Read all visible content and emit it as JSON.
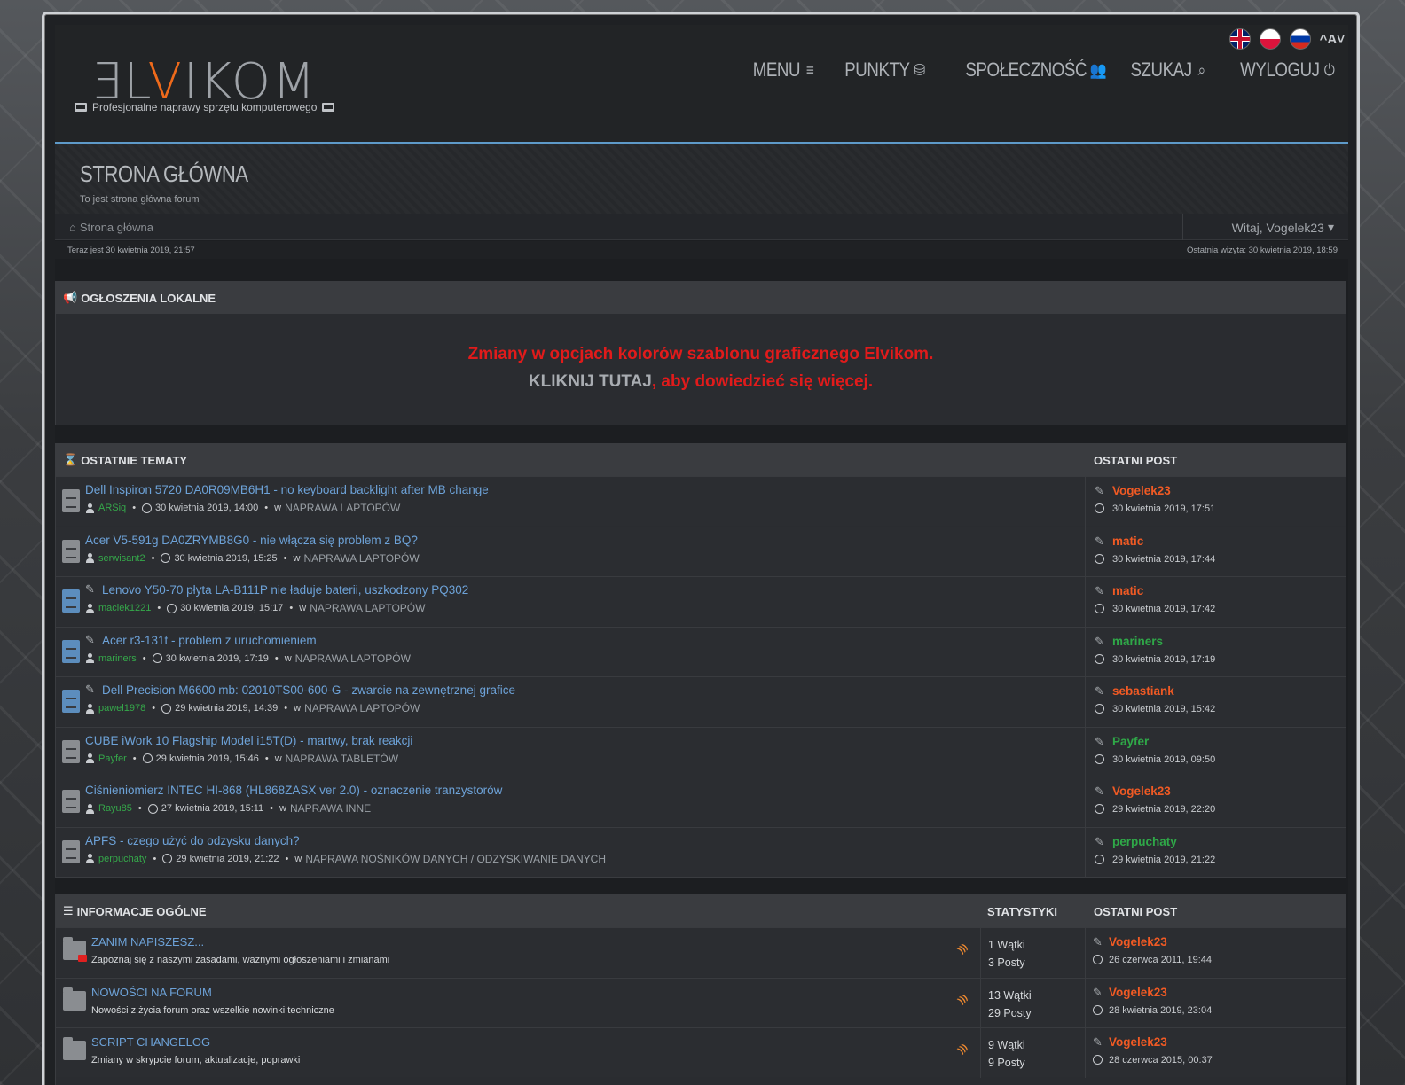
{
  "header": {
    "logo_prefix": "ƎL",
    "logo_accent": "V",
    "logo_suffix": "IKOM",
    "tagline": "Profesjonalne naprawy sprzętu komputerowego",
    "font_toggle": "^A˅",
    "nav": [
      {
        "label": "MENU",
        "icon": "≡"
      },
      {
        "label": "PUNKTY",
        "icon": "⛁"
      },
      {
        "label": "SPOŁECZNOŚĆ",
        "icon": "👥"
      },
      {
        "label": "SZUKAJ",
        "icon": "⌕"
      },
      {
        "label": "WYLOGUJ",
        "icon": "⏻"
      }
    ]
  },
  "page": {
    "title": "STRONA GŁÓWNA",
    "subtitle": "To jest strona główna forum",
    "breadcrumb_home": "Strona główna",
    "welcome": "Witaj, Vogelek23",
    "now": "Teraz jest 30 kwietnia 2019, 21:57",
    "last_visit": "Ostatnia wizyta: 30 kwietnia 2019, 18:59"
  },
  "announcements": {
    "heading": "OGŁOSZENIA LOKALNE",
    "line1": "Zmiany w opcjach kolorów szablonu graficznego Elvikom.",
    "link": "KLIKNIJ TUTAJ",
    "line2_rest": ", aby dowiedzieć się więcej."
  },
  "recent": {
    "heading": "OSTATNIE TEMATY",
    "last_post_heading": "OSTATNI POST",
    "topics": [
      {
        "title": "Dell Inspiron 5720 DA0R09MB6H1 - no keyboard backlight after MB change",
        "author": "ARSiq",
        "date": "30 kwietnia 2019, 14:00",
        "in": "w",
        "forum": "NAPRAWA LAPTOPÓW",
        "last_user": "Vogelek23",
        "last_date": "30 kwietnia 2019, 17:51"
      },
      {
        "title": "Acer V5-591g DA0ZRYMB8G0 - nie włącza się problem z BQ?",
        "author": "serwisant2",
        "date": "30 kwietnia 2019, 15:25",
        "in": "w",
        "forum": "NAPRAWA LAPTOPÓW",
        "last_user": "matic",
        "last_date": "30 kwietnia 2019, 17:44"
      },
      {
        "title": "Lenovo Y50-70 płyta LA-B111P nie ładuje baterii, uszkodzony PQ302",
        "author": "maciek1221",
        "date": "30 kwietnia 2019, 15:17",
        "in": "w",
        "forum": "NAPRAWA LAPTOPÓW",
        "last_user": "matic",
        "last_date": "30 kwietnia 2019, 17:42"
      },
      {
        "title": "Acer r3-131t - problem z uruchomieniem",
        "author": "mariners",
        "date": "30 kwietnia 2019, 17:19",
        "in": "w",
        "forum": "NAPRAWA LAPTOPÓW",
        "last_user": "mariners",
        "last_date": "30 kwietnia 2019, 17:19"
      },
      {
        "title": "Dell Precision M6600 mb: 02010TS00-600-G - zwarcie na zewnętrznej grafice",
        "author": "pawel1978",
        "date": "29 kwietnia 2019, 14:39",
        "in": "w",
        "forum": "NAPRAWA LAPTOPÓW",
        "last_user": "sebastiank",
        "last_date": "30 kwietnia 2019, 15:42"
      },
      {
        "title": "CUBE iWork 10 Flagship Model i15T(D) - martwy, brak reakcji",
        "author": "Payfer",
        "date": "29 kwietnia 2019, 15:46",
        "in": "w",
        "forum": "NAPRAWA TABLETÓW",
        "last_user": "Payfer",
        "last_date": "30 kwietnia 2019, 09:50"
      },
      {
        "title": "Ciśnieniomierz INTEC HI-868 (HL868ZASX ver 2.0) - oznaczenie tranzystorów",
        "author": "Rayu85",
        "date": "27 kwietnia 2019, 15:11",
        "in": "w",
        "forum": "NAPRAWA INNE",
        "last_user": "Vogelek23",
        "last_date": "29 kwietnia 2019, 22:20"
      },
      {
        "title": "APFS - czego użyć do odzysku danych?",
        "author": "perpuchaty",
        "date": "29 kwietnia 2019, 21:22",
        "in": "w",
        "forum": "NAPRAWA NOŚNIKÓW DANYCH / ODZYSKIWANIE DANYCH",
        "last_user": "perpuchaty",
        "last_date": "29 kwietnia 2019, 21:22"
      }
    ]
  },
  "general": {
    "heading": "INFORMACJE OGÓLNE",
    "stats_heading": "STATYSTYKI",
    "last_post_heading": "OSTATNI POST",
    "forums": [
      {
        "title": "ZANIM NAPISZESZ...",
        "desc": "Zapoznaj się z naszymi zasadami, ważnymi ogłoszeniami i zmianami",
        "threads": "1 Wątki",
        "posts": "3 Posty",
        "last_user": "Vogelek23",
        "last_date": "26 czerwca 2011, 19:44"
      },
      {
        "title": "NOWOŚCI NA FORUM",
        "desc": "Nowości z życia forum oraz wszelkie nowinki techniczne",
        "threads": "13 Wątki",
        "posts": "29 Posty",
        "last_user": "Vogelek23",
        "last_date": "28 kwietnia 2019, 23:04"
      },
      {
        "title": "SCRIPT CHANGELOG",
        "desc": "Zmiany w skrypcie forum, aktualizacje, poprawki",
        "threads": "9 Wątki",
        "posts": "9 Posty",
        "last_user": "Vogelek23",
        "last_date": "28 czerwca 2015, 00:37"
      }
    ]
  },
  "colors": {
    "accent_orange": "#f05a24",
    "user_green": "#2fa848",
    "link_blue": "#6da2d8",
    "announce_red": "#e11b1b"
  }
}
